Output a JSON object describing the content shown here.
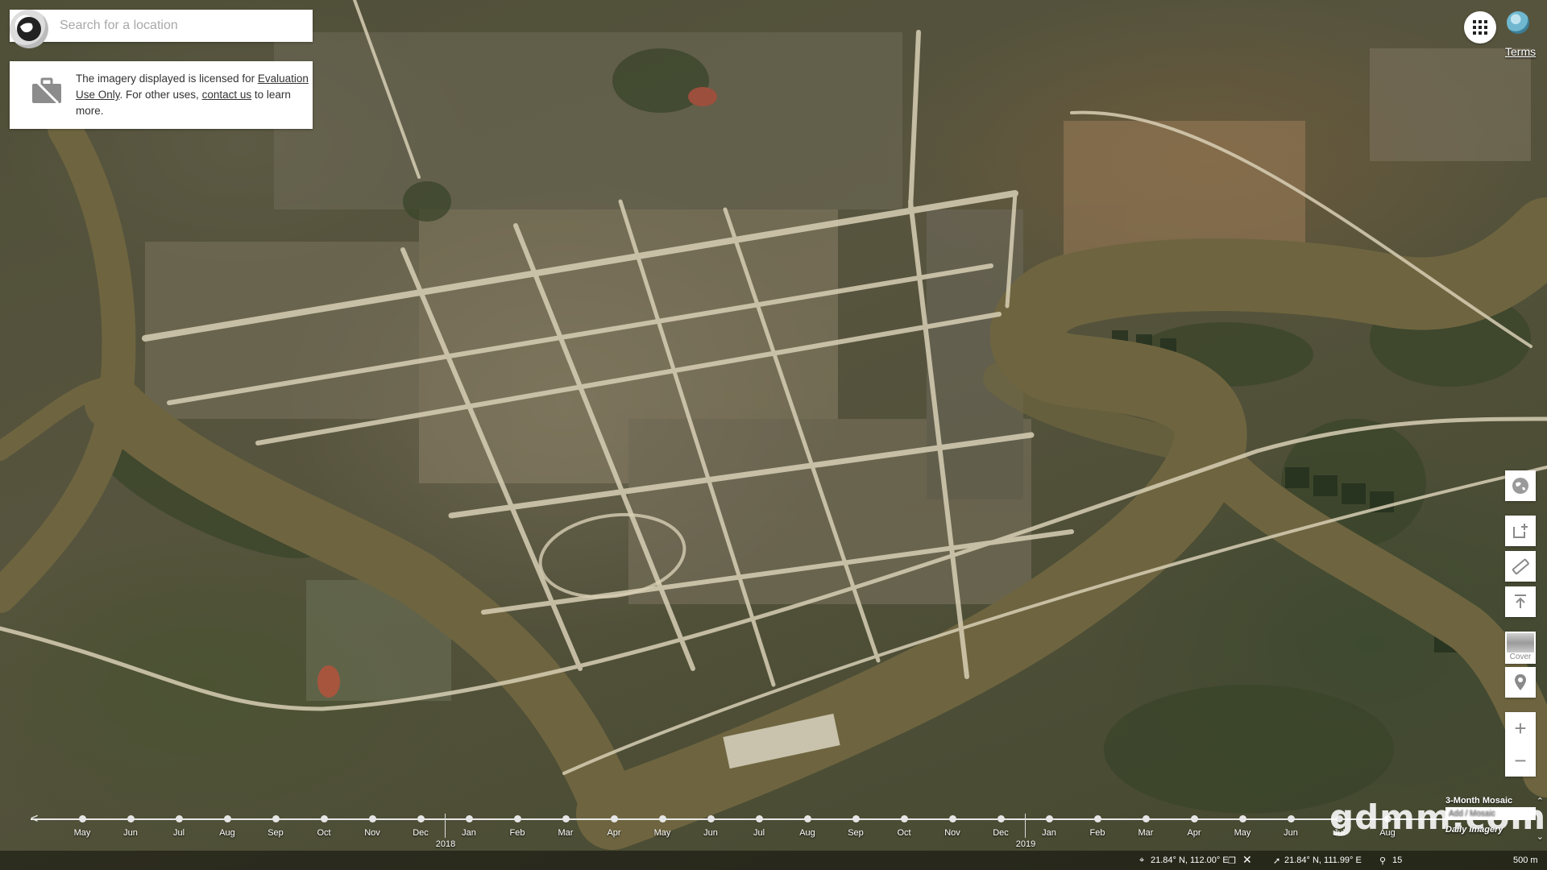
{
  "search": {
    "placeholder": "Search for a location"
  },
  "notice": {
    "text_before": "The imagery displayed is licensed for ",
    "link_eval": "Evaluation Use Only",
    "text_mid": ". For other uses, ",
    "link_contact": "contact us",
    "text_after": " to learn more."
  },
  "top_right": {
    "terms_label": "Terms",
    "icons": [
      "apps-grid-icon",
      "earth-icon"
    ]
  },
  "tools": {
    "icons": [
      "globe-icon",
      "share-icon",
      "ruler-icon",
      "upload-icon",
      "location-pin-icon"
    ],
    "cover_label": "Cover",
    "zoom_in": "+",
    "zoom_out": "−"
  },
  "timeline": {
    "months": [
      "May",
      "Jun",
      "Jul",
      "Aug",
      "Sep",
      "Oct",
      "Nov",
      "Dec",
      "Jan",
      "Feb",
      "Mar",
      "Apr",
      "May",
      "Jun",
      "Jul",
      "Aug",
      "Sep",
      "Oct",
      "Nov",
      "Dec",
      "Jan",
      "Feb",
      "Mar",
      "Apr",
      "May",
      "Jun",
      "Jul",
      "Aug"
    ],
    "years": [
      {
        "label": "2018",
        "after_index": 7
      },
      {
        "label": "2019",
        "after_index": 19
      }
    ]
  },
  "mosaic": {
    "title": "3-Month Mosaic",
    "field_placeholder": "Add / Mosaic",
    "mode_label": "Daily Imagery"
  },
  "watermark": "gdmm.com",
  "status": {
    "center_coords": "21.84° N, 112.00° E",
    "cursor_coords": "21.84° N, 111.99° E",
    "zoom_level": "15",
    "scale": "500 m"
  },
  "colors": {
    "river": "#6e6540",
    "road": "#d8cfb5",
    "vegetation": "#3f4a2d"
  }
}
